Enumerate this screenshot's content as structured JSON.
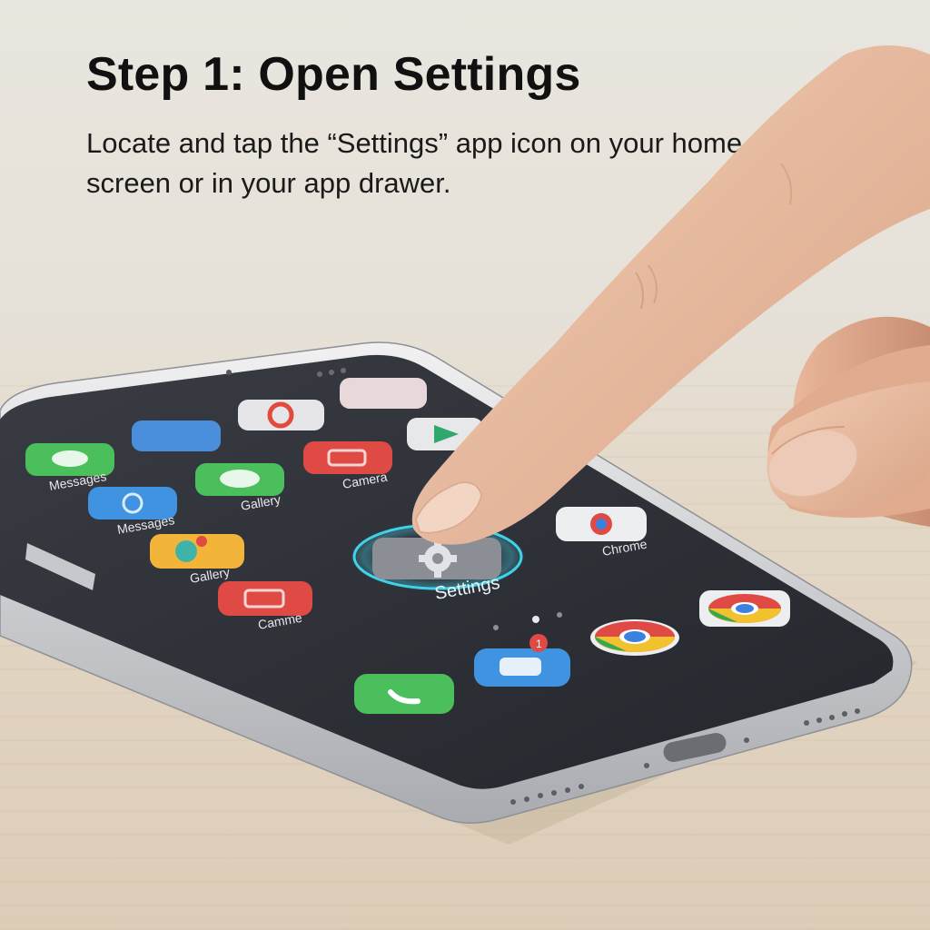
{
  "header": {
    "title": "Step 1: Open Settings",
    "description": "Locate and tap the “Settings” app icon on your home screen or in your app drawer."
  },
  "phone": {
    "apps": [
      {
        "label": "Messages",
        "icon": "messages-icon"
      },
      {
        "label": "Messages",
        "icon": "messages-icon"
      },
      {
        "label": "Gallery",
        "icon": "gallery-icon"
      },
      {
        "label": "Camme",
        "icon": "camera-icon"
      },
      {
        "label": "Gallery",
        "icon": "gallery-icon"
      },
      {
        "label": "Camera",
        "icon": "camera-icon"
      },
      {
        "label": "Chrome",
        "icon": "chrome-icon"
      }
    ],
    "settings_label": "Settings",
    "dock": [
      {
        "icon": "phone-icon"
      },
      {
        "icon": "chat-icon",
        "badge": "1"
      },
      {
        "icon": "chrome-icon"
      },
      {
        "icon": "chrome-icon"
      }
    ]
  },
  "colors": {
    "screen": "#2c2e35",
    "highlight_ring": "#3fd2e8",
    "phone_frame": "#d9dadc"
  }
}
